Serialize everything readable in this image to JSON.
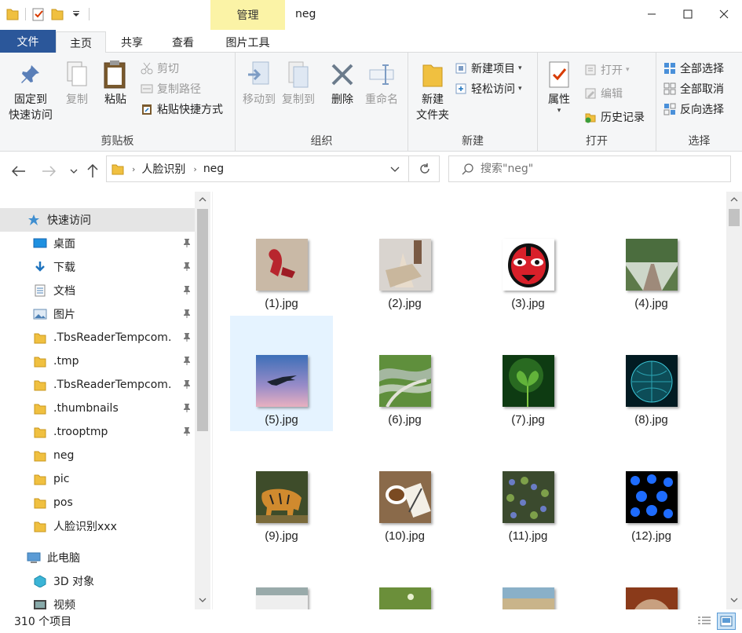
{
  "titlebar": {
    "manage_tab": "管理",
    "title": "neg"
  },
  "ribbon_tabs": {
    "file": "文件",
    "home": "主页",
    "share": "共享",
    "view": "查看",
    "picture_tools": "图片工具"
  },
  "ribbon": {
    "clipboard": {
      "label": "剪贴板",
      "pin": "固定到\n快速访问",
      "copy": "复制",
      "paste": "粘贴",
      "cut": "剪切",
      "copy_path": "复制路径",
      "paste_shortcut": "粘贴快捷方式"
    },
    "organize": {
      "label": "组织",
      "move_to": "移动到",
      "copy_to": "复制到",
      "delete": "删除",
      "rename": "重命名"
    },
    "new": {
      "label": "新建",
      "new_folder": "新建\n文件夹",
      "new_item": "新建项目",
      "easy_access": "轻松访问"
    },
    "open": {
      "label": "打开",
      "properties": "属性",
      "open": "打开",
      "edit": "编辑",
      "history": "历史记录"
    },
    "select": {
      "label": "选择",
      "select_all": "全部选择",
      "select_none": "全部取消",
      "invert": "反向选择"
    }
  },
  "address": {
    "segments": [
      "人脸识别",
      "neg"
    ],
    "search_placeholder": "搜索\"neg\""
  },
  "navpane": {
    "quick_access": "快速访问",
    "items": [
      {
        "label": "桌面",
        "pinned": true,
        "icon": "desktop-icon"
      },
      {
        "label": "下载",
        "pinned": true,
        "icon": "download-icon"
      },
      {
        "label": "文档",
        "pinned": true,
        "icon": "document-icon"
      },
      {
        "label": "图片",
        "pinned": true,
        "icon": "pictures-icon"
      },
      {
        "label": ".TbsReaderTempcom.",
        "pinned": true,
        "icon": "folder-icon"
      },
      {
        "label": ".tmp",
        "pinned": true,
        "icon": "folder-icon"
      },
      {
        "label": ".TbsReaderTempcom.",
        "pinned": true,
        "icon": "folder-icon"
      },
      {
        "label": ".thumbnails",
        "pinned": true,
        "icon": "folder-icon"
      },
      {
        "label": ".trooptmp",
        "pinned": true,
        "icon": "folder-icon"
      },
      {
        "label": "neg",
        "pinned": false,
        "icon": "folder-icon"
      },
      {
        "label": "pic",
        "pinned": false,
        "icon": "folder-icon"
      },
      {
        "label": "pos",
        "pinned": false,
        "icon": "folder-icon"
      },
      {
        "label": "人脸识别xxx",
        "pinned": false,
        "icon": "folder-icon"
      }
    ],
    "this_pc": "此电脑",
    "pc_items": [
      {
        "label": "3D 对象",
        "icon": "3d-objects-icon"
      },
      {
        "label": "视频",
        "icon": "video-icon"
      }
    ]
  },
  "files": [
    {
      "name": "(1).jpg",
      "selected": false
    },
    {
      "name": "(2).jpg",
      "selected": false
    },
    {
      "name": "(3).jpg",
      "selected": false
    },
    {
      "name": "(4).jpg",
      "selected": false
    },
    {
      "name": "(5).jpg",
      "selected": true
    },
    {
      "name": "(6).jpg",
      "selected": false
    },
    {
      "name": "(7).jpg",
      "selected": false
    },
    {
      "name": "(8).jpg",
      "selected": false
    },
    {
      "name": "(9).jpg",
      "selected": false
    },
    {
      "name": "(10).jpg",
      "selected": false
    },
    {
      "name": "(11).jpg",
      "selected": false
    },
    {
      "name": "(12).jpg",
      "selected": false
    }
  ],
  "statusbar": {
    "count": "310 个项目"
  },
  "colors": {
    "file_tab": "#2b579a",
    "manage_tab": "#fbf3a6",
    "selection": "#e5f3ff",
    "folder": "#f0c040"
  }
}
